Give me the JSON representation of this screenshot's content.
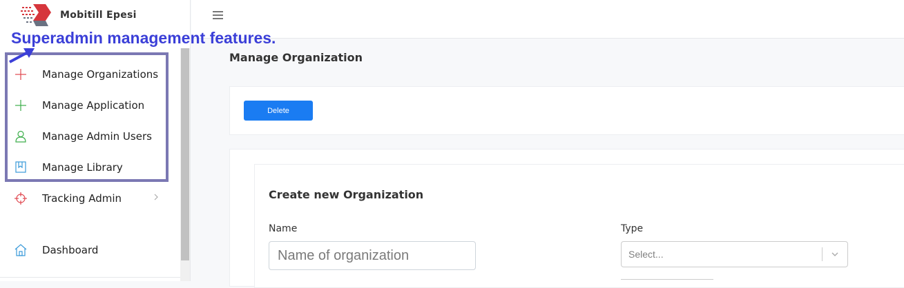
{
  "app": {
    "name": "Mobitill Epesi"
  },
  "annotation": {
    "text": "Superadmin management features."
  },
  "sidebar": {
    "items": [
      {
        "label": "Manage Organizations",
        "icon": "plus-icon",
        "color": "#e0464e"
      },
      {
        "label": "Manage Application",
        "icon": "plus-icon",
        "color": "#3cae4a"
      },
      {
        "label": "Manage Admin Users",
        "icon": "user-icon",
        "color": "#3cae4a"
      },
      {
        "label": "Manage Library",
        "icon": "bookmark-icon",
        "color": "#3a9ad9"
      },
      {
        "label": "Tracking Admin",
        "icon": "crosshair-icon",
        "color": "#e0464e",
        "has_submenu": true
      },
      {
        "label": "Dashboard",
        "icon": "home-icon",
        "color": "#3a9ad9"
      }
    ]
  },
  "header": {
    "menu_icon": "hamburger-icon"
  },
  "page": {
    "title": "Manage Organization",
    "delete_label": "Delete",
    "form": {
      "title": "Create new Organization",
      "name_label": "Name",
      "name_placeholder": "Name of organization",
      "type_label": "Type",
      "type_placeholder": "Select..."
    }
  },
  "colors": {
    "primary": "#1a7cf2",
    "annotation": "#3b3fd8",
    "highlight_border": "#7b78b3"
  }
}
